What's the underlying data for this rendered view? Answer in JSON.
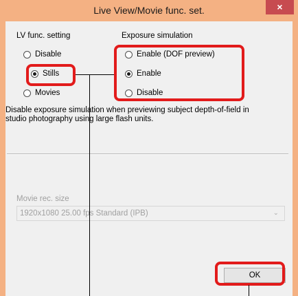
{
  "window": {
    "title": "Live View/Movie func. set.",
    "close_glyph": "×"
  },
  "lv_func": {
    "heading": "LV func. setting",
    "options": [
      {
        "label": "Disable",
        "checked": false
      },
      {
        "label": "Stills",
        "checked": true
      },
      {
        "label": "Movies",
        "checked": false
      }
    ]
  },
  "exposure": {
    "heading": "Exposure simulation",
    "options": [
      {
        "label": "Enable (DOF preview)",
        "checked": false
      },
      {
        "label": "Enable",
        "checked": true
      },
      {
        "label": "Disable",
        "checked": false
      }
    ]
  },
  "description": "Disable exposure simulation when previewing subject depth-of-field in studio photography using large flash units.",
  "movie": {
    "label": "Movie rec. size",
    "value": "1920x1080  25.00 fps Standard (IPB)"
  },
  "ok_label": "OK",
  "colors": {
    "titlebar": "#f4b183",
    "close": "#c74b50",
    "highlight": "#e21b1b"
  }
}
